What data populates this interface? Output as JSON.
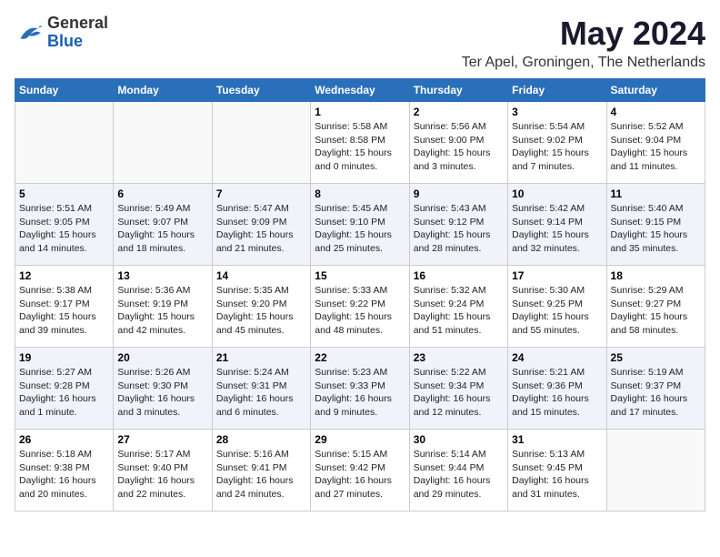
{
  "header": {
    "logo_line1": "General",
    "logo_line2": "Blue",
    "main_title": "May 2024",
    "subtitle": "Ter Apel, Groningen, The Netherlands"
  },
  "days_of_week": [
    "Sunday",
    "Monday",
    "Tuesday",
    "Wednesday",
    "Thursday",
    "Friday",
    "Saturday"
  ],
  "weeks": [
    {
      "alt": false,
      "days": [
        {
          "num": "",
          "info": ""
        },
        {
          "num": "",
          "info": ""
        },
        {
          "num": "",
          "info": ""
        },
        {
          "num": "1",
          "info": "Sunrise: 5:58 AM\nSunset: 8:58 PM\nDaylight: 15 hours\nand 0 minutes."
        },
        {
          "num": "2",
          "info": "Sunrise: 5:56 AM\nSunset: 9:00 PM\nDaylight: 15 hours\nand 3 minutes."
        },
        {
          "num": "3",
          "info": "Sunrise: 5:54 AM\nSunset: 9:02 PM\nDaylight: 15 hours\nand 7 minutes."
        },
        {
          "num": "4",
          "info": "Sunrise: 5:52 AM\nSunset: 9:04 PM\nDaylight: 15 hours\nand 11 minutes."
        }
      ]
    },
    {
      "alt": true,
      "days": [
        {
          "num": "5",
          "info": "Sunrise: 5:51 AM\nSunset: 9:05 PM\nDaylight: 15 hours\nand 14 minutes."
        },
        {
          "num": "6",
          "info": "Sunrise: 5:49 AM\nSunset: 9:07 PM\nDaylight: 15 hours\nand 18 minutes."
        },
        {
          "num": "7",
          "info": "Sunrise: 5:47 AM\nSunset: 9:09 PM\nDaylight: 15 hours\nand 21 minutes."
        },
        {
          "num": "8",
          "info": "Sunrise: 5:45 AM\nSunset: 9:10 PM\nDaylight: 15 hours\nand 25 minutes."
        },
        {
          "num": "9",
          "info": "Sunrise: 5:43 AM\nSunset: 9:12 PM\nDaylight: 15 hours\nand 28 minutes."
        },
        {
          "num": "10",
          "info": "Sunrise: 5:42 AM\nSunset: 9:14 PM\nDaylight: 15 hours\nand 32 minutes."
        },
        {
          "num": "11",
          "info": "Sunrise: 5:40 AM\nSunset: 9:15 PM\nDaylight: 15 hours\nand 35 minutes."
        }
      ]
    },
    {
      "alt": false,
      "days": [
        {
          "num": "12",
          "info": "Sunrise: 5:38 AM\nSunset: 9:17 PM\nDaylight: 15 hours\nand 39 minutes."
        },
        {
          "num": "13",
          "info": "Sunrise: 5:36 AM\nSunset: 9:19 PM\nDaylight: 15 hours\nand 42 minutes."
        },
        {
          "num": "14",
          "info": "Sunrise: 5:35 AM\nSunset: 9:20 PM\nDaylight: 15 hours\nand 45 minutes."
        },
        {
          "num": "15",
          "info": "Sunrise: 5:33 AM\nSunset: 9:22 PM\nDaylight: 15 hours\nand 48 minutes."
        },
        {
          "num": "16",
          "info": "Sunrise: 5:32 AM\nSunset: 9:24 PM\nDaylight: 15 hours\nand 51 minutes."
        },
        {
          "num": "17",
          "info": "Sunrise: 5:30 AM\nSunset: 9:25 PM\nDaylight: 15 hours\nand 55 minutes."
        },
        {
          "num": "18",
          "info": "Sunrise: 5:29 AM\nSunset: 9:27 PM\nDaylight: 15 hours\nand 58 minutes."
        }
      ]
    },
    {
      "alt": true,
      "days": [
        {
          "num": "19",
          "info": "Sunrise: 5:27 AM\nSunset: 9:28 PM\nDaylight: 16 hours\nand 1 minute."
        },
        {
          "num": "20",
          "info": "Sunrise: 5:26 AM\nSunset: 9:30 PM\nDaylight: 16 hours\nand 3 minutes."
        },
        {
          "num": "21",
          "info": "Sunrise: 5:24 AM\nSunset: 9:31 PM\nDaylight: 16 hours\nand 6 minutes."
        },
        {
          "num": "22",
          "info": "Sunrise: 5:23 AM\nSunset: 9:33 PM\nDaylight: 16 hours\nand 9 minutes."
        },
        {
          "num": "23",
          "info": "Sunrise: 5:22 AM\nSunset: 9:34 PM\nDaylight: 16 hours\nand 12 minutes."
        },
        {
          "num": "24",
          "info": "Sunrise: 5:21 AM\nSunset: 9:36 PM\nDaylight: 16 hours\nand 15 minutes."
        },
        {
          "num": "25",
          "info": "Sunrise: 5:19 AM\nSunset: 9:37 PM\nDaylight: 16 hours\nand 17 minutes."
        }
      ]
    },
    {
      "alt": false,
      "days": [
        {
          "num": "26",
          "info": "Sunrise: 5:18 AM\nSunset: 9:38 PM\nDaylight: 16 hours\nand 20 minutes."
        },
        {
          "num": "27",
          "info": "Sunrise: 5:17 AM\nSunset: 9:40 PM\nDaylight: 16 hours\nand 22 minutes."
        },
        {
          "num": "28",
          "info": "Sunrise: 5:16 AM\nSunset: 9:41 PM\nDaylight: 16 hours\nand 24 minutes."
        },
        {
          "num": "29",
          "info": "Sunrise: 5:15 AM\nSunset: 9:42 PM\nDaylight: 16 hours\nand 27 minutes."
        },
        {
          "num": "30",
          "info": "Sunrise: 5:14 AM\nSunset: 9:44 PM\nDaylight: 16 hours\nand 29 minutes."
        },
        {
          "num": "31",
          "info": "Sunrise: 5:13 AM\nSunset: 9:45 PM\nDaylight: 16 hours\nand 31 minutes."
        },
        {
          "num": "",
          "info": ""
        }
      ]
    }
  ]
}
